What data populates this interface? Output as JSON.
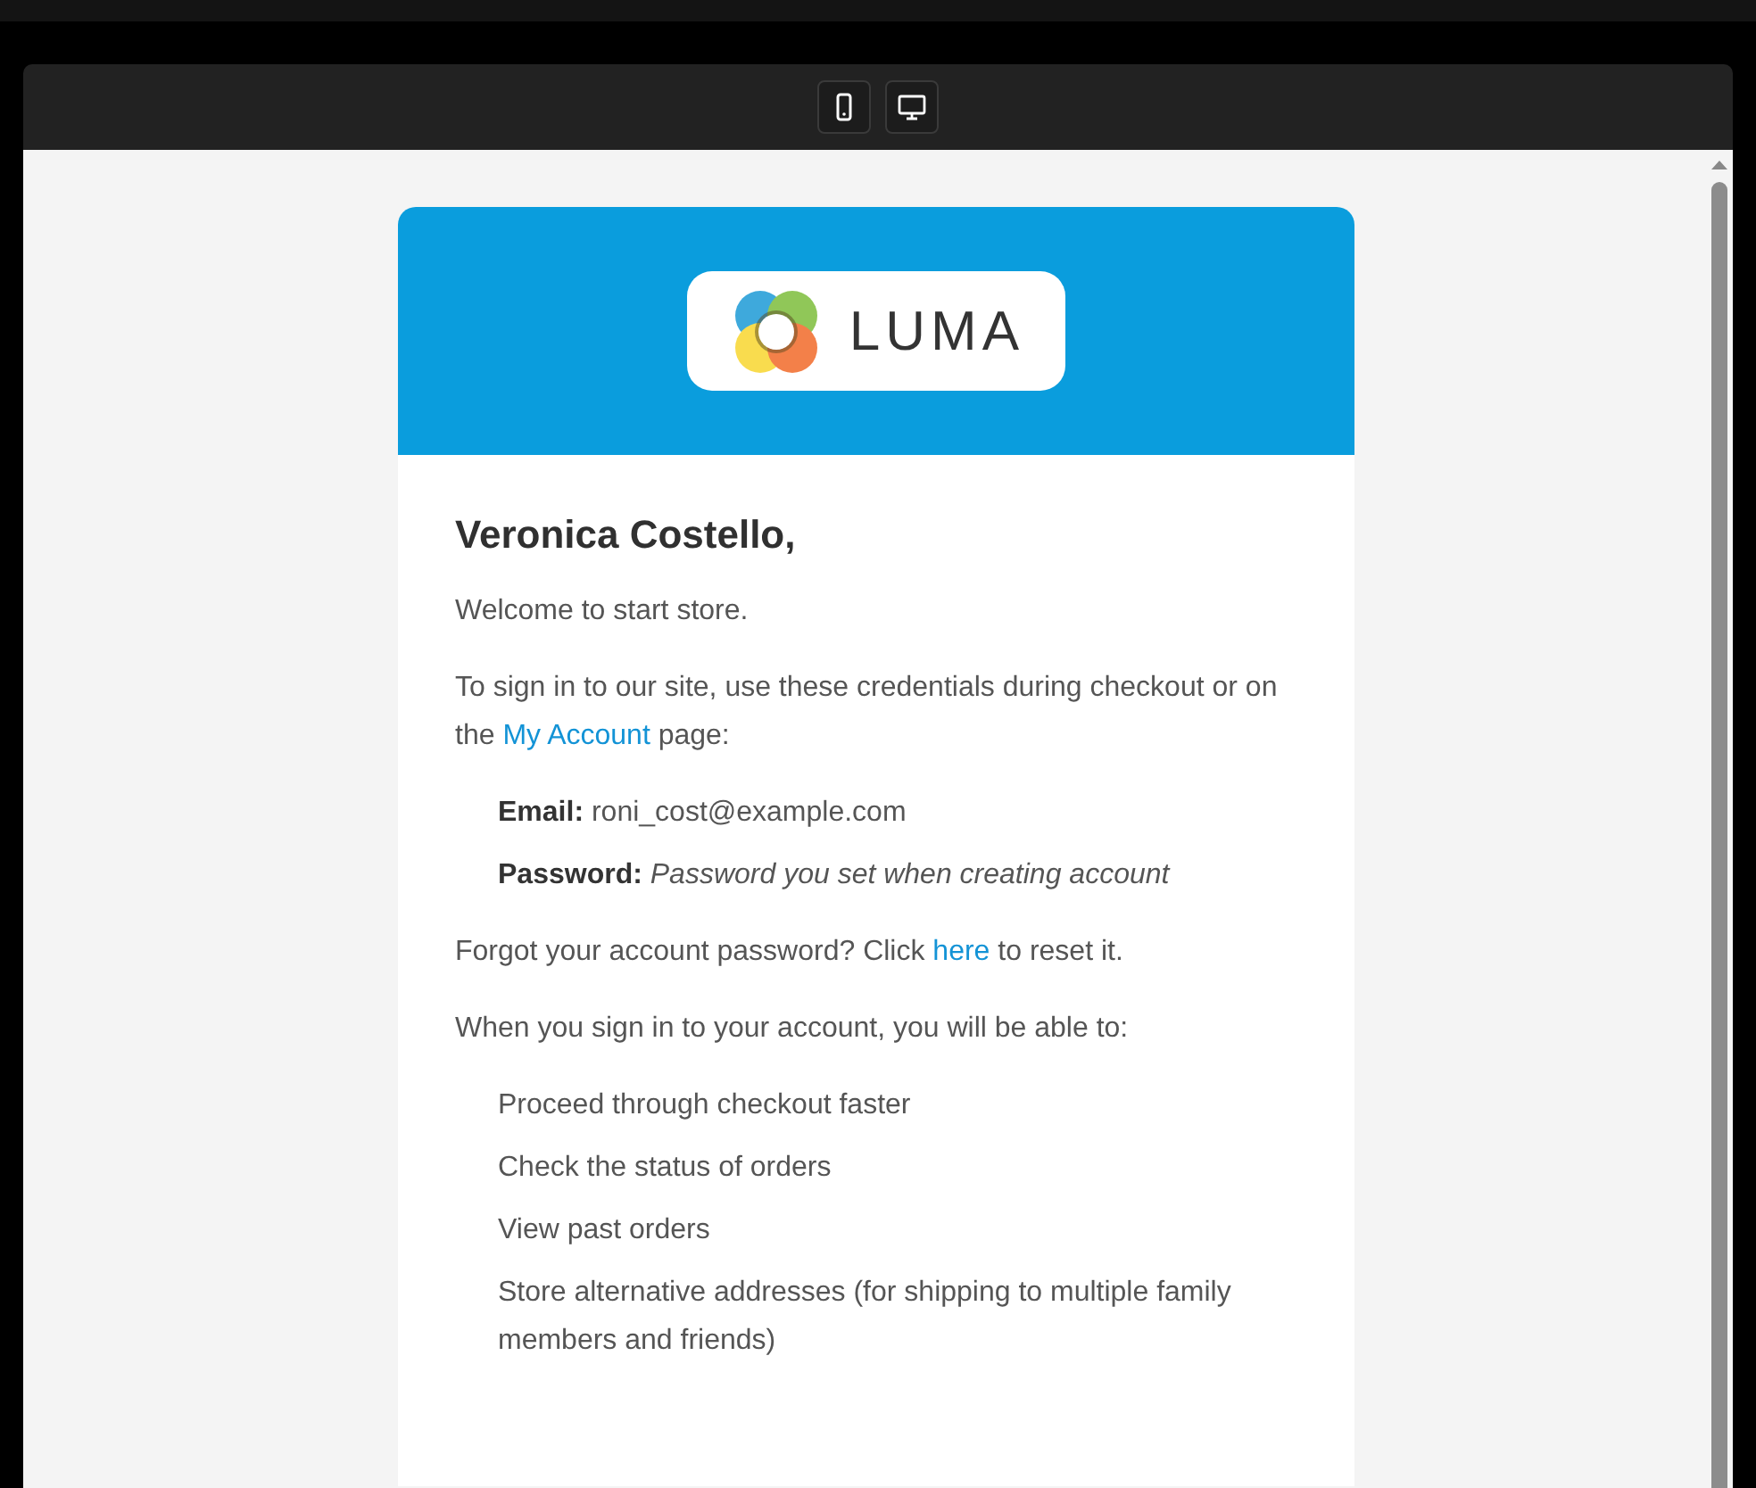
{
  "toolbar": {
    "buttons": [
      {
        "kind": "mobile"
      },
      {
        "kind": "desktop"
      }
    ]
  },
  "email": {
    "logo": {
      "text": "LUMA"
    },
    "greeting": "Veronica Costello,",
    "intro": "Welcome to start store.",
    "sign_in": {
      "before": "To sign in to our site, use these credentials during checkout or on the ",
      "link": "My Account",
      "after": " page:"
    },
    "credentials": [
      "**Email:** roni_cost@example.com",
      "**Password:** *Password you set when creating account*"
    ],
    "forgot": {
      "before": "Forgot your account password? Click ",
      "link": "here",
      "after": " to reset it."
    },
    "benefits_intro": "When you sign in to your account, you will be able to:",
    "benefits": [
      "Proceed through checkout faster",
      "Check the status of orders",
      "View past orders",
      "Store alternative addresses (for shipping to multiple family members and friends)"
    ]
  }
}
